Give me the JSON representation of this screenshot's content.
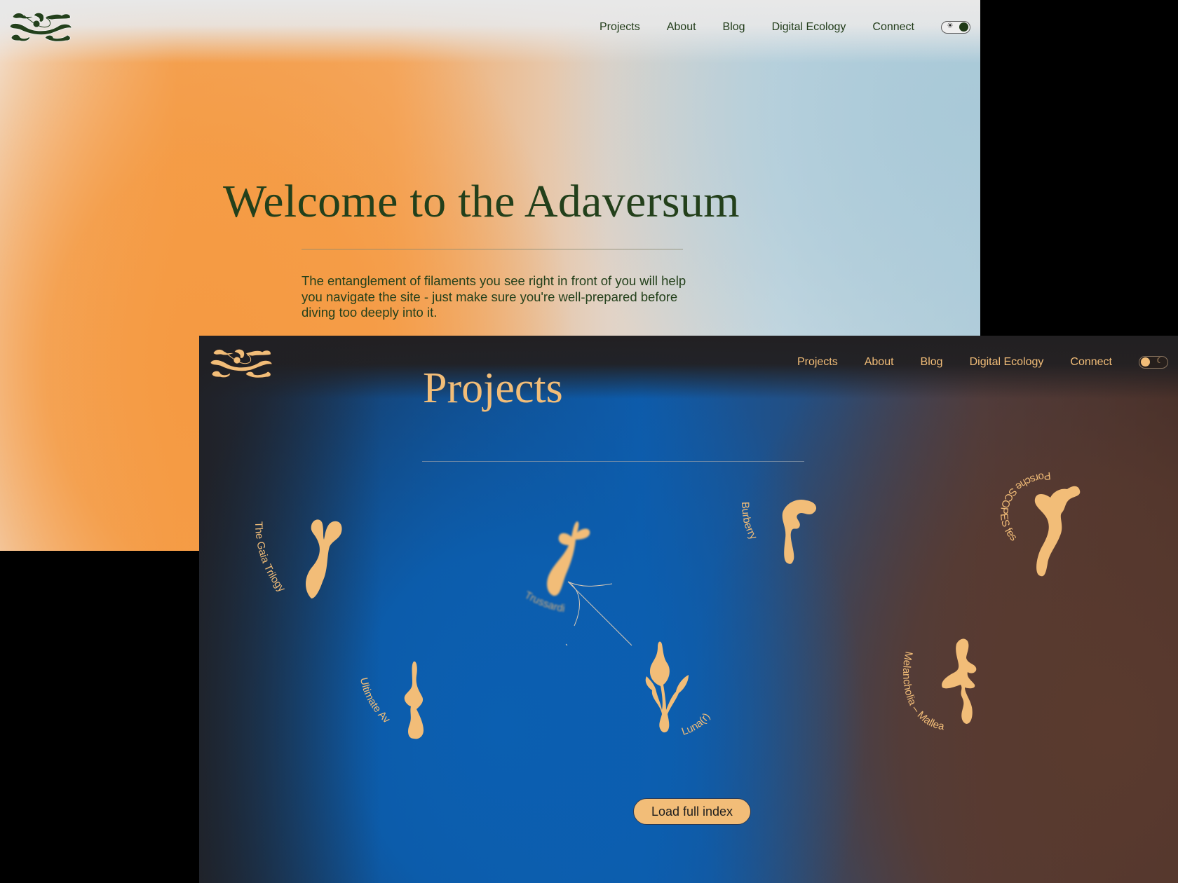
{
  "light_window": {
    "logo": "adaversum-logo",
    "nav": {
      "items": [
        {
          "label": "Projects"
        },
        {
          "label": "About"
        },
        {
          "label": "Blog"
        },
        {
          "label": "Digital Ecology"
        },
        {
          "label": "Connect"
        }
      ],
      "theme_toggle": {
        "state": "light",
        "icon": "sun-icon",
        "symbol": "☀"
      }
    },
    "heading": "Welcome to the Adaversum",
    "intro": "The entanglement of filaments you see right in front of you will help you navigate the site - just make sure you're well-prepared before diving too deeply into it.",
    "colors": {
      "text": "#23401b",
      "accent_orange": "#f59a42",
      "accent_blue": "#a9c9d8"
    }
  },
  "dark_window": {
    "logo": "adaversum-logo",
    "nav": {
      "items": [
        {
          "label": "Projects"
        },
        {
          "label": "About"
        },
        {
          "label": "Blog"
        },
        {
          "label": "Digital Ecology"
        },
        {
          "label": "Connect"
        }
      ],
      "theme_toggle": {
        "state": "dark",
        "icon": "moon-icon",
        "symbol": "☾"
      }
    },
    "heading": "Projects",
    "projects": [
      {
        "label": "The Gaia Trilogy"
      },
      {
        "label": "Trussardi",
        "hovered": true
      },
      {
        "label": "Burberry"
      },
      {
        "label": "Porsche SCOPES festival"
      },
      {
        "label": "Ultimate Ave"
      },
      {
        "label": "Luna(r)"
      },
      {
        "label": "Melancholia – Malleable II"
      }
    ],
    "load_button": "Load full index",
    "colors": {
      "accent": "#f2bd78",
      "blue": "#0e5aa8",
      "brown": "#5a3a2e"
    }
  }
}
